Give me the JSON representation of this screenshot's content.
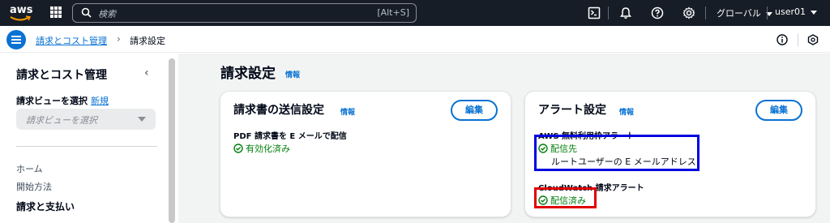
{
  "topbar": {
    "logo_text": "aws",
    "search_placeholder": "検索",
    "search_shortcut": "[Alt+S]",
    "region": "グローバル",
    "user": "user01"
  },
  "breadcrumb": {
    "parent": "請求とコスト管理",
    "separator": "›",
    "current": "請求設定"
  },
  "sidebar": {
    "title": "請求とコスト管理",
    "collapse": "‹",
    "view_label": "請求ビューを選択",
    "view_new": "新規",
    "view_placeholder": "請求ビューを選択",
    "items": [
      {
        "label": "ホーム"
      },
      {
        "label": "開始方法"
      }
    ],
    "section": "請求と支払い"
  },
  "main": {
    "title": "請求設定",
    "info": "情報",
    "cards": [
      {
        "title": "請求書の送信設定",
        "info": "情報",
        "edit": "編集",
        "field_label": "PDF 請求書を E メールで配信",
        "status": "有効化済み"
      },
      {
        "title": "アラート設定",
        "info": "情報",
        "edit": "編集",
        "field1_label": "AWS 無料利用枠アラート",
        "field1_status": "配信先",
        "field1_sub": "ルートユーザーの E メールアドレス",
        "field2_label": "CloudWatch 請求アラート",
        "field2_status": "配信済み"
      }
    ]
  },
  "colors": {
    "nav_bg": "#161d26",
    "link": "#0972d3",
    "success": "#037f0c",
    "highlight_blue": "#0000e0",
    "highlight_red": "#e00000"
  }
}
